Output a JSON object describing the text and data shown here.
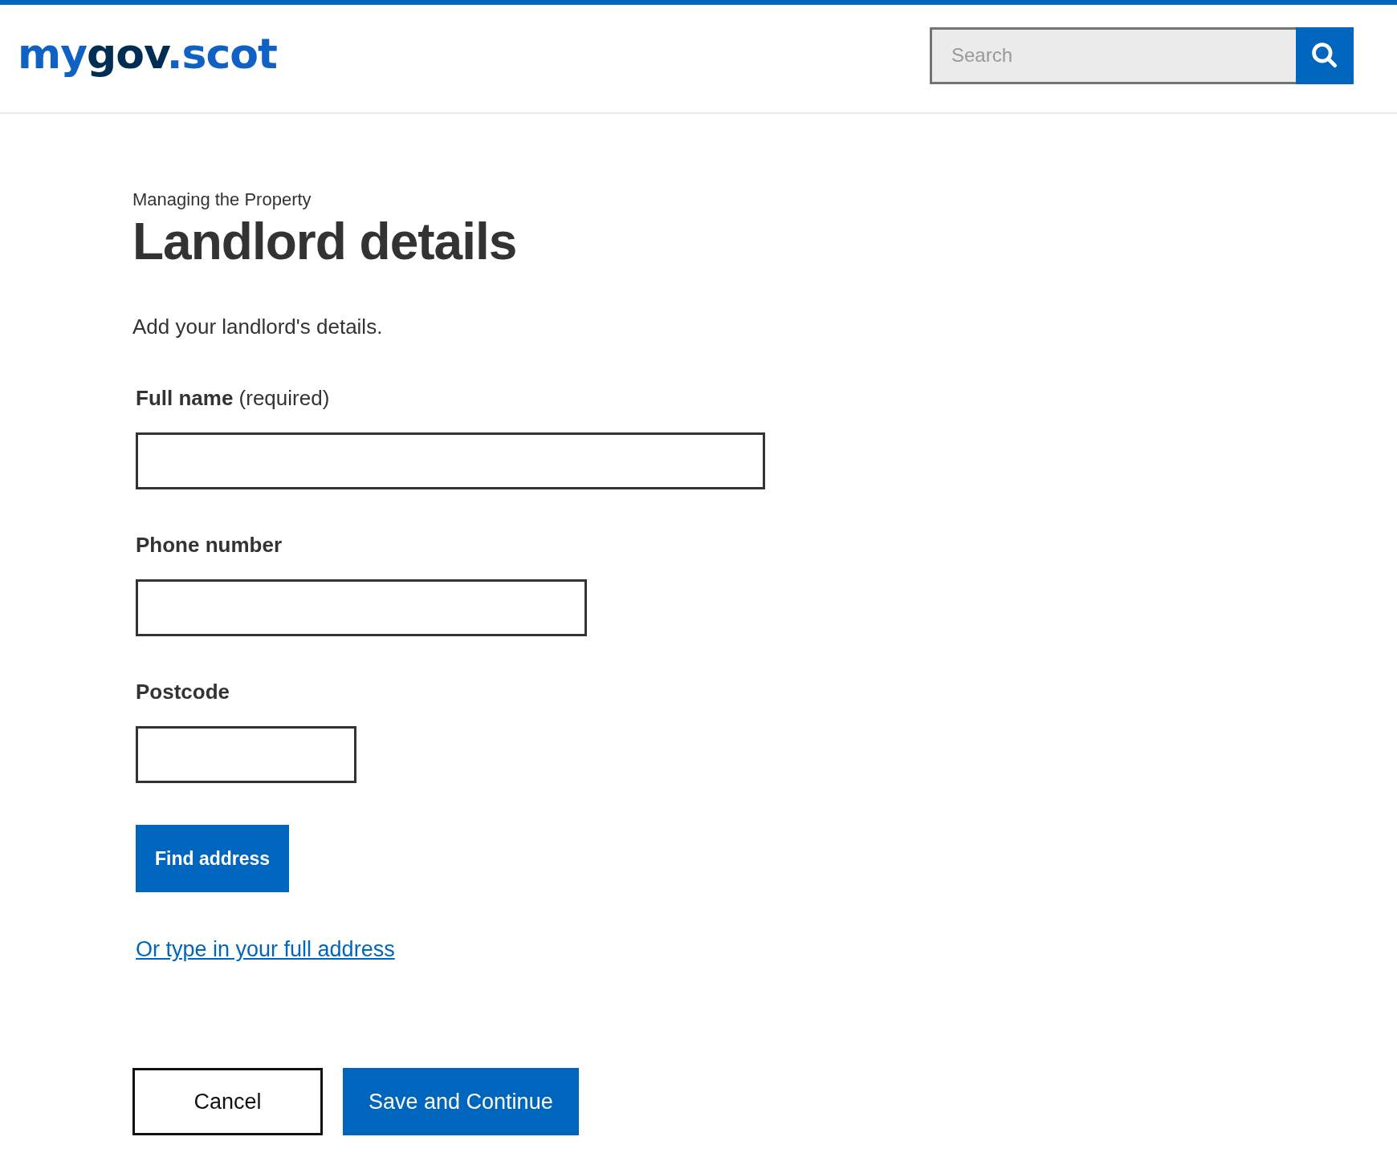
{
  "header": {
    "logo": [
      {
        "text": "my",
        "kind": "light"
      },
      {
        "text": "gov",
        "kind": "dark"
      },
      {
        "text": ".scot",
        "kind": "light"
      }
    ],
    "search": {
      "placeholder": "Search"
    }
  },
  "caption": "Managing the Property",
  "title": "Landlord details",
  "intro": "Add your landlord's details.",
  "fields": [
    {
      "label": "**Full name** (required)",
      "kind": "wide"
    },
    {
      "label": "**Phone number**",
      "kind": "medium"
    },
    {
      "label": "**Postcode**",
      "kind": "narrow"
    }
  ],
  "find_button": "Find address",
  "manual_link": "Or type in your full address",
  "actions": [
    {
      "label": "Cancel",
      "kind": "secondary"
    },
    {
      "label": "Save and Continue",
      "kind": "primary"
    }
  ]
}
